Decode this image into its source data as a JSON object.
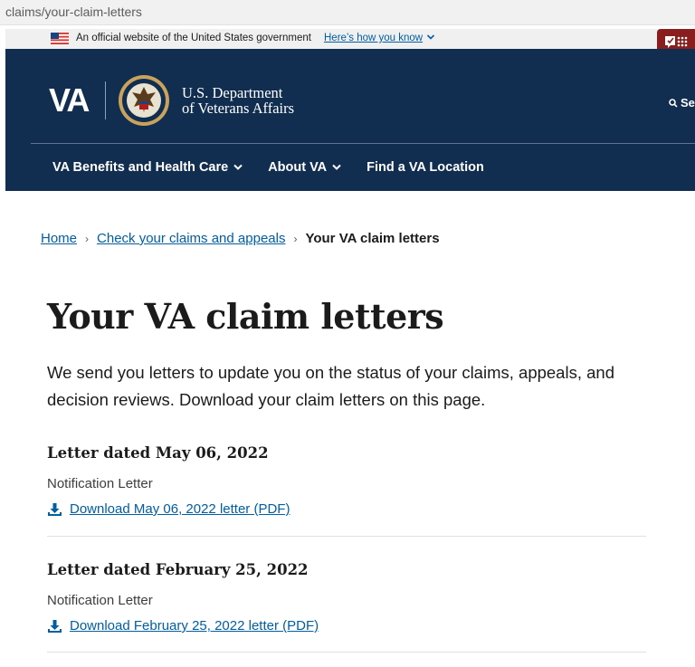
{
  "browser": {
    "url": "claims/your-claim-letters"
  },
  "gov_banner": {
    "text": "An official website of the United States government",
    "link": "Here’s how you know"
  },
  "header": {
    "logo_text": "VA",
    "dept_line1": "U.S. Department",
    "dept_line2": "of Veterans Affairs",
    "search_label": "Se"
  },
  "nav": {
    "items": [
      {
        "label": "VA Benefits and Health Care"
      },
      {
        "label": "About VA"
      },
      {
        "label": "Find a VA Location"
      }
    ]
  },
  "breadcrumb": {
    "home": "Home",
    "claims": "Check your claims and appeals",
    "current": "Your VA claim letters"
  },
  "main": {
    "title": "Your VA claim letters",
    "intro": "We send you letters to update you on the status of your claims, appeals, and decision reviews. Download your claim letters on this page.",
    "letters": [
      {
        "heading": "Letter dated May 06, 2022",
        "type": "Notification Letter",
        "download": "Download May 06, 2022 letter (PDF)"
      },
      {
        "heading": "Letter dated February 25, 2022",
        "type": "Notification Letter",
        "download": "Download February 25, 2022 letter (PDF)"
      }
    ]
  },
  "colors": {
    "header_bg": "#112e51",
    "link": "#005ea2",
    "feedback_bg": "#8a1d1d"
  }
}
